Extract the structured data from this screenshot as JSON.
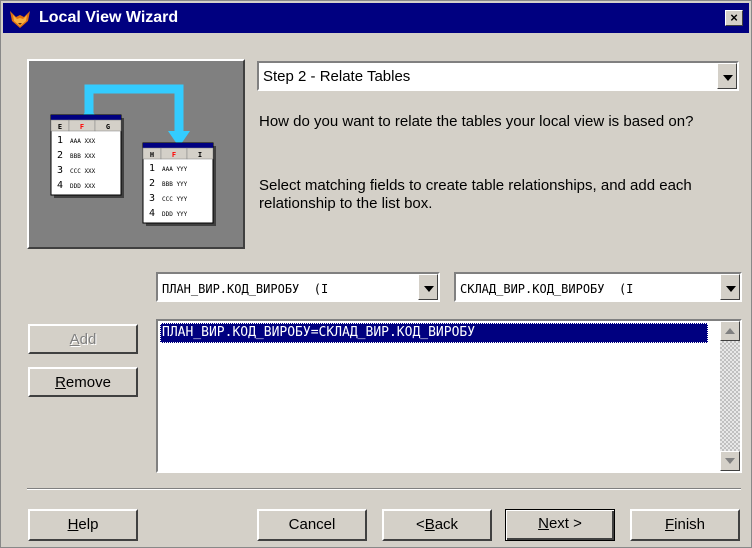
{
  "window": {
    "title": "Local View Wizard",
    "close_label": "×"
  },
  "step": {
    "selected": "Step 2 - Relate Tables"
  },
  "instructions": {
    "question": "How do you want to relate the tables your local view is based on?",
    "hint": "Select matching fields to create table relationships, and add each relationship to the list box."
  },
  "illustration": {
    "table1": {
      "headers": [
        "E",
        "F",
        "G"
      ],
      "rows": [
        [
          "1",
          "AAA",
          "XXX"
        ],
        [
          "2",
          "BBB",
          "XXX"
        ],
        [
          "3",
          "CCC",
          "XXX"
        ],
        [
          "4",
          "DDD",
          "XXX"
        ]
      ]
    },
    "table2": {
      "headers": [
        "H",
        "F",
        "I"
      ],
      "rows": [
        [
          "1",
          "AAA",
          "YYY"
        ],
        [
          "2",
          "BBB",
          "YYY"
        ],
        [
          "3",
          "CCC",
          "YYY"
        ],
        [
          "4",
          "DDD",
          "YYY"
        ]
      ]
    },
    "arrow_color": "#33ccff",
    "link_color": "#ff0000"
  },
  "fields": {
    "left_value": "ПЛАН_ВИР.КОД_ВИРОБУ  (I",
    "right_value": "СКЛАД_ВИР.КОД_ВИРОБУ  (I"
  },
  "buttons": {
    "add_access": "A",
    "add_rest": "dd",
    "remove_access": "R",
    "remove_rest": "emove",
    "help_access": "H",
    "help_rest": "elp",
    "cancel": "Cancel",
    "back_prefix": "< ",
    "back_access": "B",
    "back_rest": "ack",
    "next_access": "N",
    "next_rest": "ext >",
    "finish_access": "F",
    "finish_rest": "inish"
  },
  "relationships": [
    "ПЛАН_ВИР.КОД_ВИРОБУ=СКЛАД_ВИР.КОД_ВИРОБУ"
  ],
  "colors": {
    "titlebar": "#000080",
    "face": "#d4d0c8",
    "selection": "#000080"
  }
}
